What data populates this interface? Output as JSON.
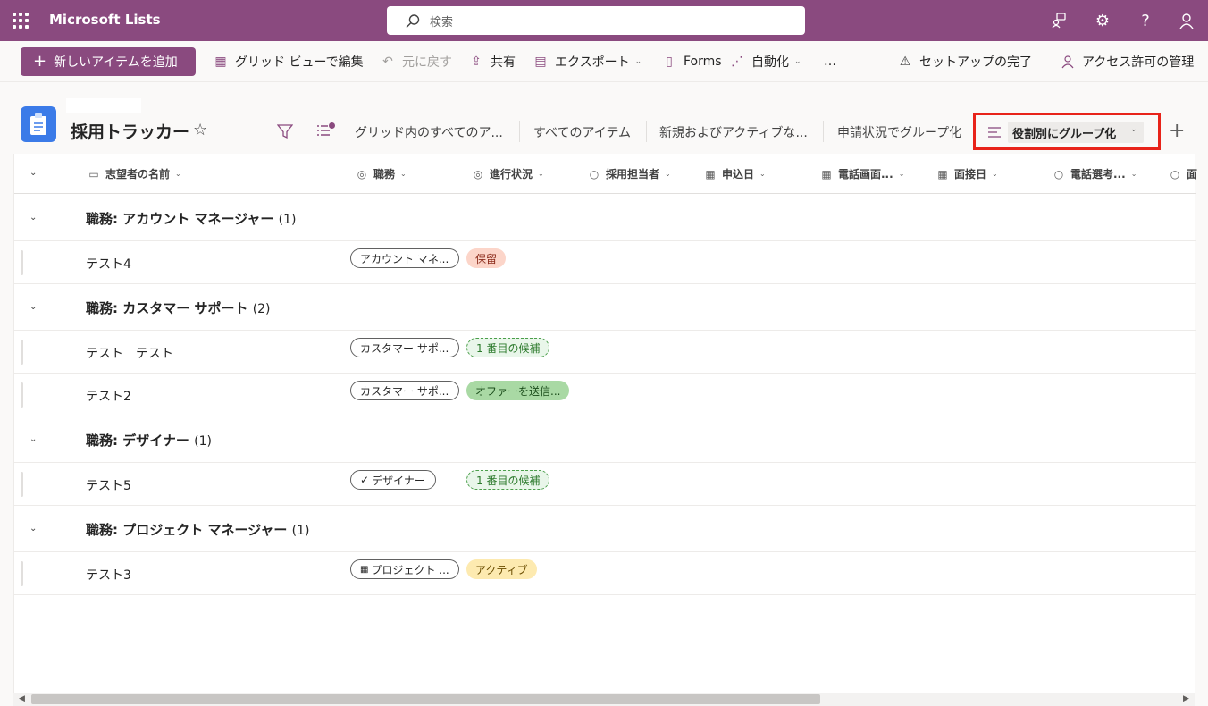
{
  "app": {
    "title": "Microsoft Lists",
    "search_placeholder": "検索"
  },
  "toolbar": {
    "new_item": "新しいアイテムを追加",
    "grid_edit": "グリッド ビューで編集",
    "undo": "元に戻す",
    "share": "共有",
    "export": "エクスポート",
    "forms": "Forms",
    "automate": "自動化",
    "more": "…",
    "setup_complete": "セットアップの完了",
    "manage_access": "アクセス許可の管理"
  },
  "list": {
    "title": "採用トラッカー",
    "views": [
      "グリッド内のすべてのア...",
      "すべてのアイテム",
      "新規およびアクティブな...",
      "申請状況でグループ化"
    ],
    "active_view": "役割別にグループ化"
  },
  "columns": [
    "志望者の名前",
    "職務",
    "進行状況",
    "採用担当者",
    "申込日",
    "電話画面...",
    "面接日",
    "電話選考...",
    "面"
  ],
  "groups": [
    {
      "label": "職務: アカウント マネージャー",
      "count": "(1)",
      "rows": [
        {
          "name": "テスト4",
          "role": "アカウント マネ...",
          "status": "保留"
        }
      ]
    },
    {
      "label": "職務: カスタマー サポート",
      "count": "(2)",
      "rows": [
        {
          "name": "テスト　テスト",
          "role": "カスタマー サポ...",
          "status": "1 番目の候補"
        },
        {
          "name": "テスト2",
          "role": "カスタマー サポ...",
          "status": "オファーを送信..."
        }
      ]
    },
    {
      "label": "職務: デザイナー",
      "count": "(1)",
      "rows": [
        {
          "name": "テスト5",
          "role": "デザイナー",
          "status": "1 番目の候補"
        }
      ]
    },
    {
      "label": "職務: プロジェクト マネージャー",
      "count": "(1)",
      "rows": [
        {
          "name": "テスト3",
          "role": "プロジェクト ...",
          "status": "アクティブ"
        }
      ]
    }
  ],
  "colors": {
    "brand": "#8a4a7f",
    "highlight_box": "#e8231a",
    "list_icon": "#3b7be8"
  }
}
